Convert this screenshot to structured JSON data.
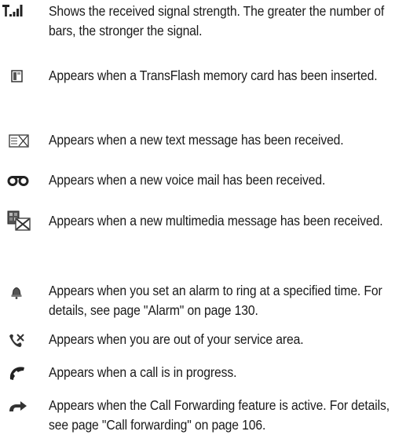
{
  "items": [
    {
      "icon": "signal-strength-icon",
      "text": "Shows the received signal strength. The greater the number of bars, the stronger the signal."
    },
    {
      "icon": "memory-card-icon",
      "text": "Appears when a TransFlash memory card has been inserted."
    },
    {
      "icon": "text-message-icon",
      "text": "Appears when a new text message has been received."
    },
    {
      "icon": "voice-mail-icon",
      "text": "Appears when a new voice mail has been received."
    },
    {
      "icon": "multimedia-message-icon",
      "text": "Appears when a new multimedia message has been received."
    },
    {
      "icon": "alarm-icon",
      "text": "Appears when you set an alarm to ring at a specified time. For details, see page \"Alarm\" on page 130."
    },
    {
      "icon": "no-service-icon",
      "text": "Appears when you are out of your service area."
    },
    {
      "icon": "call-in-progress-icon",
      "text": "Appears when a call is in progress."
    },
    {
      "icon": "call-forwarding-icon",
      "text": "Appears when the Call Forwarding feature is active. For details, see page \"Call forwarding\" on page 106."
    }
  ]
}
